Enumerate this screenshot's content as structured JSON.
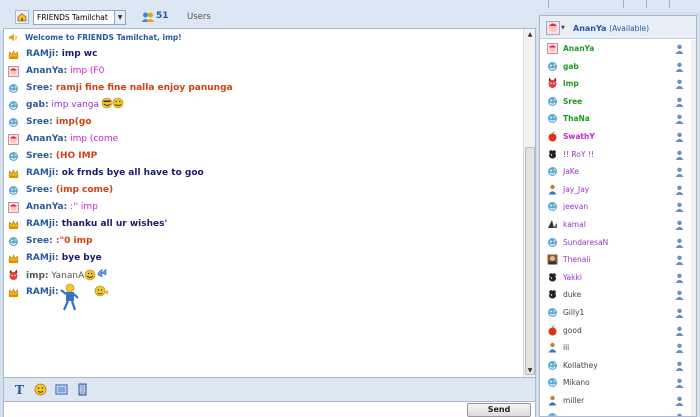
{
  "topbar": {
    "room": "FRIENDS Tamilchat",
    "user_count": "51",
    "users_label": "Users"
  },
  "chat": {
    "welcome": "Welcome to FRIENDS Tamilchat,  imp!",
    "messages": [
      {
        "name": "RAMji:",
        "text": " imp wc",
        "name_color": "#2b5a9c",
        "text_color": "#1a1a6e",
        "bold": true,
        "icon": "crown-icon"
      },
      {
        "name": "AnanYa:",
        "text": " imp (F0",
        "name_color": "#2b5a9c",
        "text_color": "#cc22cc",
        "bold": false,
        "icon": "girl-avatar-icon"
      },
      {
        "name": "Sree:",
        "text": " ramji fine fine nalla enjoy panunga",
        "name_color": "#2b5a9c",
        "text_color": "#d04010",
        "bold": true,
        "icon": "messenger-icon"
      },
      {
        "name": "gab:",
        "text": " imp vanga",
        "name_color": "#2b5a9c",
        "text_color": "#9933cc",
        "bold": false,
        "icon": "messenger-icon",
        "emoji": "smiley-pair-icon"
      },
      {
        "name": "Sree:",
        "text": " imp(go",
        "name_color": "#2b5a9c",
        "text_color": "#d04010",
        "bold": true,
        "icon": "messenger-icon"
      },
      {
        "name": "AnanYa:",
        "text": " imp (come",
        "name_color": "#2b5a9c",
        "text_color": "#cc22cc",
        "bold": false,
        "icon": "girl-avatar-icon"
      },
      {
        "name": "Sree:",
        "text": " (HO IMP",
        "name_color": "#2b5a9c",
        "text_color": "#d04010",
        "bold": true,
        "icon": "messenger-icon"
      },
      {
        "name": "RAMji:",
        "text": " ok frnds bye all have to goo",
        "name_color": "#2b5a9c",
        "text_color": "#1a1a6e",
        "bold": true,
        "icon": "crown-icon"
      },
      {
        "name": "Sree:",
        "text": " (imp come)",
        "name_color": "#2b5a9c",
        "text_color": "#d04010",
        "bold": true,
        "icon": "messenger-icon"
      },
      {
        "name": "AnanYa:",
        "text": " :'' imp",
        "name_color": "#2b5a9c",
        "text_color": "#cc22cc",
        "bold": false,
        "icon": "girl-avatar-icon"
      },
      {
        "name": "RAMji:",
        "text": " thanku all ur wishes'",
        "name_color": "#2b5a9c",
        "text_color": "#1a1a6e",
        "bold": true,
        "icon": "crown-icon"
      },
      {
        "name": "Sree:",
        "text": " :\"0 imp",
        "name_color": "#2b5a9c",
        "text_color": "#d04010",
        "bold": true,
        "icon": "messenger-icon"
      },
      {
        "name": "RAMji:",
        "text": " bye bye",
        "name_color": "#2b5a9c",
        "text_color": "#1a1a6e",
        "bold": true,
        "icon": "crown-icon"
      },
      {
        "name": "imp:",
        "text": " YananA",
        "name_color": "#555555",
        "text_color": "#555555",
        "bold": false,
        "icon": "devil-icon",
        "emoji": "smiley-butterfly-icon"
      },
      {
        "name": "RAMji:",
        "text": "",
        "name_color": "#2b5a9c",
        "text_color": "#1a1a6e",
        "bold": true,
        "icon": "crown-icon",
        "emoji": "dancer-icon"
      }
    ]
  },
  "input": {
    "send_label": "Send"
  },
  "userlist": {
    "me": {
      "name": "AnanYa",
      "status": "(Available)"
    },
    "users": [
      {
        "name": "AnanYa",
        "color": "#229922",
        "bold": true,
        "icon": "girl-avatar-icon"
      },
      {
        "name": "gab",
        "color": "#229922",
        "bold": true,
        "icon": "messenger-icon"
      },
      {
        "name": "imp",
        "color": "#229922",
        "bold": true,
        "icon": "devil-icon"
      },
      {
        "name": "Sree",
        "color": "#229922",
        "bold": true,
        "icon": "messenger-icon"
      },
      {
        "name": "ThaNa",
        "color": "#229922",
        "bold": true,
        "icon": "messenger-icon"
      },
      {
        "name": "SwathY",
        "color": "#cc22cc",
        "bold": true,
        "icon": "apple-icon"
      },
      {
        "name": "!! RoY !!",
        "color": "#9933cc",
        "bold": false,
        "icon": "dog-icon"
      },
      {
        "name": "JaKe",
        "color": "#9933cc",
        "bold": false,
        "icon": "messenger-icon"
      },
      {
        "name": "Jay_Jay",
        "color": "#9933cc",
        "bold": false,
        "icon": "person-icon"
      },
      {
        "name": "jeevan",
        "color": "#9933cc",
        "bold": false,
        "icon": "messenger-icon"
      },
      {
        "name": "kamal",
        "color": "#9933cc",
        "bold": false,
        "icon": "shark-icon"
      },
      {
        "name": "SundaresaN",
        "color": "#9933cc",
        "bold": false,
        "icon": "messenger-icon"
      },
      {
        "name": "Thenali",
        "color": "#9933cc",
        "bold": false,
        "icon": "photo-avatar-icon"
      },
      {
        "name": "Yakki",
        "color": "#9933cc",
        "bold": false,
        "icon": "dog-icon"
      },
      {
        "name": "duke",
        "color": "#444444",
        "bold": false,
        "icon": "dog-icon"
      },
      {
        "name": "Gilly1",
        "color": "#444444",
        "bold": false,
        "icon": "messenger-icon"
      },
      {
        "name": "good",
        "color": "#444444",
        "bold": false,
        "icon": "apple-icon"
      },
      {
        "name": "iii",
        "color": "#444444",
        "bold": false,
        "icon": "person-icon"
      },
      {
        "name": "Kollathey",
        "color": "#444444",
        "bold": false,
        "icon": "messenger-icon"
      },
      {
        "name": "Mikano",
        "color": "#444444",
        "bold": false,
        "icon": "messenger-icon"
      },
      {
        "name": "miller",
        "color": "#444444",
        "bold": false,
        "icon": "person-icon"
      },
      {
        "name": "",
        "color": "#444444",
        "bold": false,
        "icon": "messenger-icon"
      }
    ]
  }
}
